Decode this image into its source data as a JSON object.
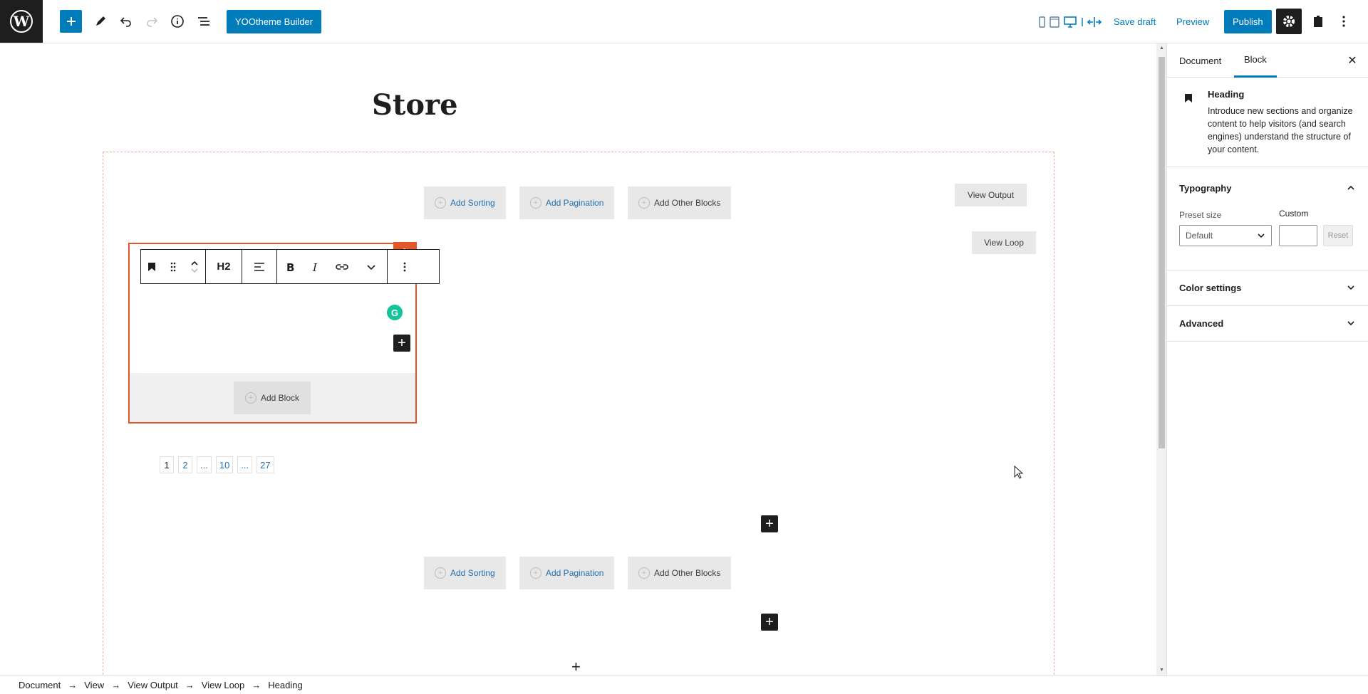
{
  "topbar": {
    "yootheme_label": "YOOtheme Builder",
    "save_draft_label": "Save draft",
    "preview_label": "Preview",
    "publish_label": "Publish"
  },
  "canvas": {
    "page_title": "Store",
    "top_actions": [
      "Add Sorting",
      "Add Pagination",
      "Add Other Blocks"
    ],
    "bottom_actions": [
      "Add Sorting",
      "Add Pagination",
      "Add Other Blocks"
    ],
    "view_output_label": "View Output",
    "view_loop_label": "View Loop",
    "heading_level": "H2",
    "add_block_label": "Add Block",
    "pagination": [
      "1",
      "2",
      "...",
      "10",
      "...",
      "27"
    ],
    "append_symbol": "+"
  },
  "sidebar": {
    "tabs": [
      "Document",
      "Block"
    ],
    "active_tab": "Block",
    "close_symbol": "✕",
    "block_card": {
      "title": "Heading",
      "description": "Introduce new sections and organize content to help visitors (and search engines) understand the structure of your content."
    },
    "typography": {
      "title": "Typography",
      "preset_label": "Preset size",
      "preset_value": "Default",
      "custom_label": "Custom",
      "custom_value": "",
      "reset_label": "Reset"
    },
    "color_settings_title": "Color settings",
    "advanced_title": "Advanced"
  },
  "breadcrumb": [
    "Document",
    "View",
    "View Output",
    "View Loop",
    "Heading"
  ],
  "breadcrumb_separator": "→",
  "colors": {
    "accent": "#007cba",
    "selection": "#e2562b",
    "grammarly": "#15c39a"
  }
}
